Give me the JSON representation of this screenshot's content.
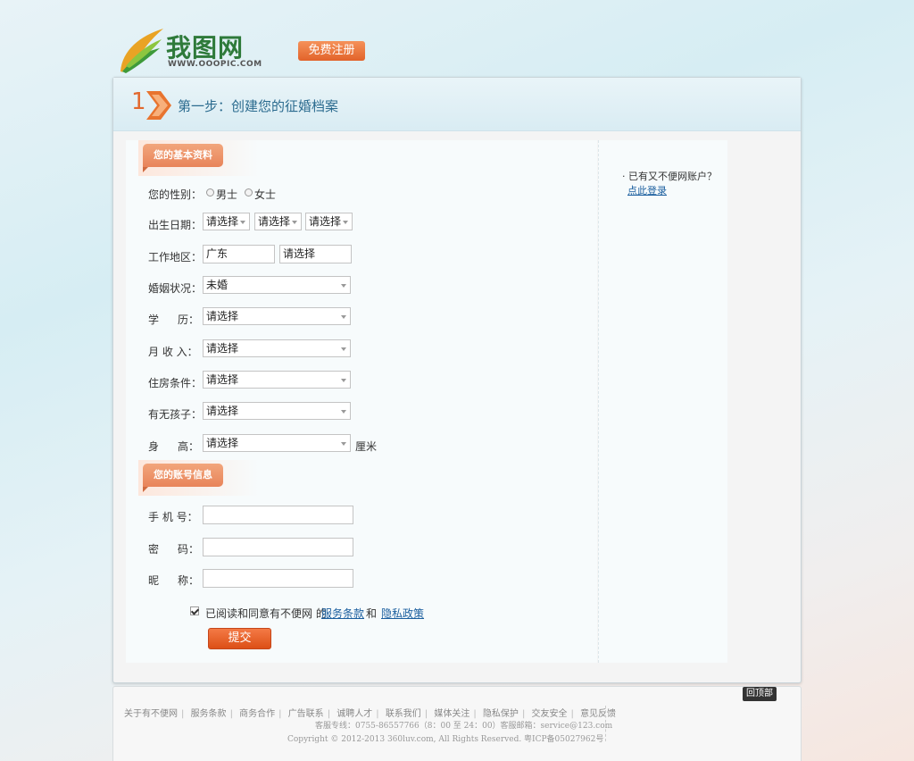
{
  "header": {
    "logo_text": "我图网",
    "logo_url": "WWW.OOOPIC.COM",
    "register_button": "免费注册"
  },
  "step": {
    "number": "1",
    "title": "第一步：创建您的征婚档案"
  },
  "basic_section": {
    "tag": "您的基本资料",
    "gender_label": "您的性别：",
    "gender_options": [
      "男士",
      "女士"
    ],
    "birth_label": "出生日期：",
    "birth_selects": [
      "请选择",
      "请选择",
      "请选择"
    ],
    "region_label": "工作地区：",
    "region_values": [
      "广东",
      "请选择"
    ],
    "marital_label": "婚姻状况：",
    "marital_value": "未婚",
    "education_label_a": "学",
    "education_label_b": "历：",
    "education_value": "请选择",
    "income_label": "月 收 入：",
    "income_value": "请选择",
    "housing_label": "住房条件：",
    "housing_value": "请选择",
    "children_label": "有无孩子：",
    "children_value": "请选择",
    "height_label_a": "身",
    "height_label_b": "高：",
    "height_value": "请选择",
    "height_unit": "厘米"
  },
  "account_section": {
    "tag": "您的账号信息",
    "phone_label": "手 机 号：",
    "password_label_a": "密",
    "password_label_b": "码：",
    "nickname_label_a": "昵",
    "nickname_label_b": "称：",
    "phone_value": "",
    "password_value": "",
    "nickname_value": ""
  },
  "agreement": {
    "text": "已阅读和同意有不便网 的",
    "terms_link": "服务条款",
    "and": "和",
    "privacy_link": "隐私政策"
  },
  "submit_button": "提交",
  "side": {
    "question": "· 已有又不便网账户？",
    "login_link": "点此登录"
  },
  "footer": {
    "links": [
      "关于有不便网",
      "服务条款",
      "商务合作",
      "广告联系",
      "诚聘人才",
      "联系我们",
      "媒体关注",
      "隐私保护",
      "交友安全",
      "意见反馈"
    ],
    "line2": "客服专线：0755-86557766（8：00 至 24：00）客服邮箱：service@123.com",
    "line3": "Copyright © 2012-2013 360luv.com, All Rights Reserved.   粤ICP备05027962号"
  },
  "back_to_top": "回顶部",
  "colors": {
    "accent_orange": "#e2632a",
    "header_blue": "#2b6b8f",
    "link_blue": "#1a5e9e"
  }
}
